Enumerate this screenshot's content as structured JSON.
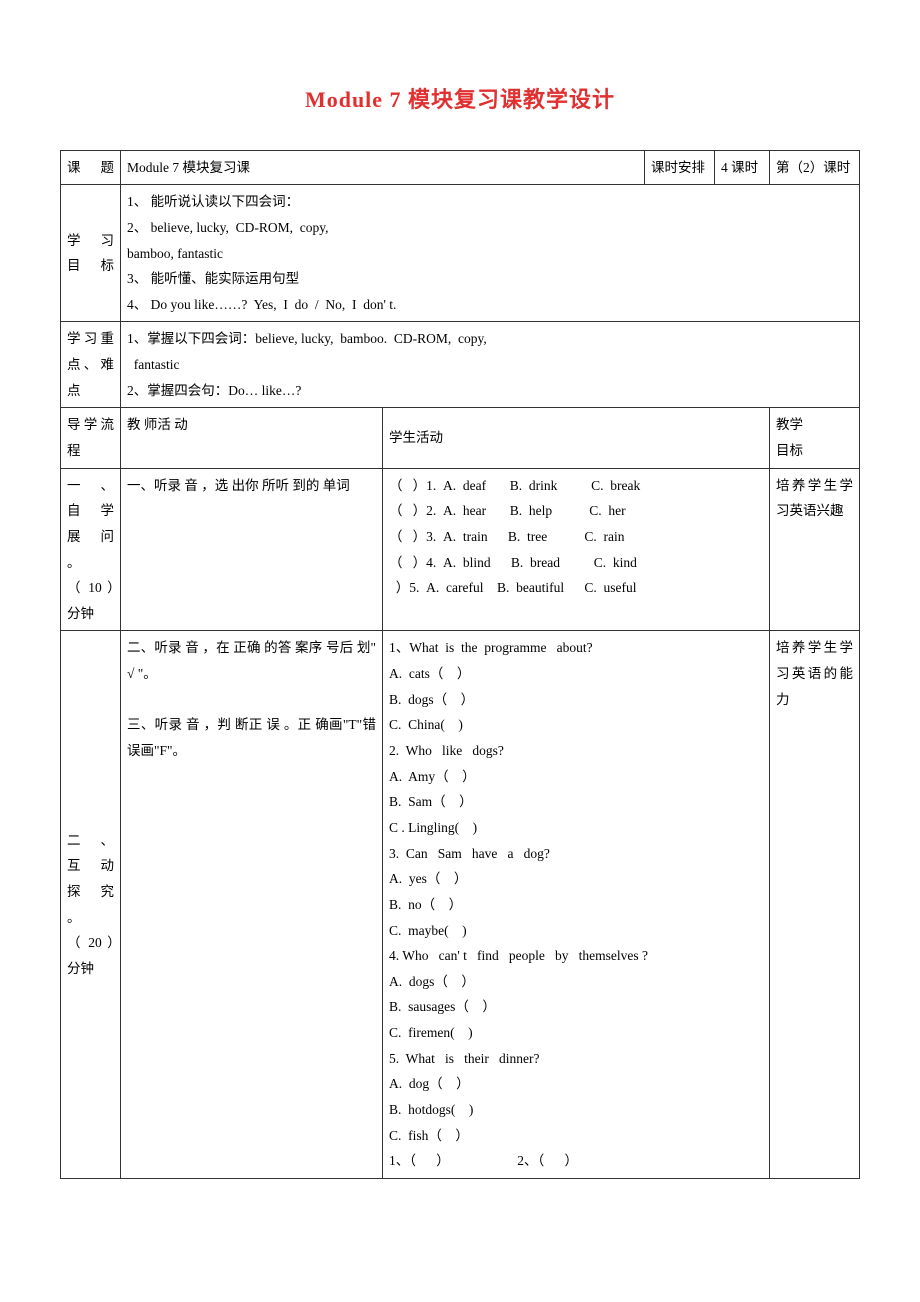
{
  "title": "Module 7 模块复习课教学设计",
  "row_topic": {
    "label": "课 题",
    "value": "Module 7 模块复习课",
    "schedule_label": "课时安排",
    "schedule_value": "4 课时",
    "period": "第（2）课时"
  },
  "row_goals": {
    "label": "学习\n目标",
    "value": "1、 能听说认读以下四会词：\n2、 believe, lucky,  CD-ROM,  copy,\nbamboo, fantastic\n3、 能听懂、能实际运用句型\n4、 Do you like……?  Yes,  I  do  /  No,  I  don' t."
  },
  "row_keypoints": {
    "label": "学习重点、难点",
    "value": "1、掌握以下四会词：believe, lucky,  bamboo.  CD-ROM,  copy,\n  fantastic\n2、掌握四会句：Do… like…?"
  },
  "row_flow_header": {
    "col1": "导学流程",
    "col2": "教 师活 动",
    "col3": "学生活动",
    "col4": "教学\n目标"
  },
  "section1": {
    "label": "一 、 自 学 展 问 。\n（ 10 ）分钟",
    "teacher": "一、听录 音 ，选 出你 所听 到的 单词",
    "student": "（   ）1.  A.  deaf       B.  drink          C.  break\n（   ）2.  A.  hear       B.  help           C.  her\n（   ）3.  A.  train      B.  tree           C.  rain\n（   ）4.  A.  blind      B.  bread          C.  kind\n  ）5.  A.  careful    B.  beautiful      C.  useful",
    "goal": "培养学生学习英语兴趣"
  },
  "section2": {
    "label": "二 、 互 动 探 究 。\n（ 20 ）分钟",
    "teacher": "二、听录 音 ，在 正确 的答 案序 号后 划\" √ \"。\n\n三、听录 音 ，判 断正 误 。正 确画\"T\"错 误画\"F\"。",
    "student": "1、What  is  the  programme   about?\nA.  cats（    ）\nB.  dogs（    ）\nC.  China(    )\n2.  Who   like   dogs?\nA.  Amy（    ）\nB.  Sam（    ）\nC . Lingling(    )\n3.  Can   Sam   have   a   dog?\nA.  yes（    ）\nB.  no（    ）\nC.  maybe(    )\n4. Who   can' t   find   people   by   themselves ?\nA.  dogs（    ）\nB.  sausages（    ）\nC.  firemen(    )\n5.  What   is   their   dinner?\nA.  dog（    ）\nB.  hotdogs(    )\nC.  fish（    ）\n1、（      ）                    2、（      ）",
    "goal": "培养学生学习英语的能力"
  }
}
